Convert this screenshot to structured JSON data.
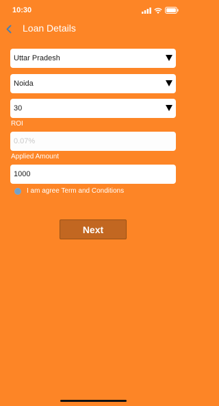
{
  "status_bar": {
    "time": "10:30"
  },
  "header": {
    "title": "Loan Details"
  },
  "form": {
    "state": "Uttar Pradesh",
    "city": "Noida",
    "tenure": "30",
    "roi_label": "ROI",
    "roi_value": "0.07%",
    "applied_amount_label": "Applied Amount",
    "applied_amount_value": "1000",
    "terms_label": "I am agree Term and Conditions",
    "terms_checked": false
  },
  "actions": {
    "next_label": "Next"
  },
  "colors": {
    "background": "#fd8526",
    "button": "#c26721",
    "radio": "#74a1c7"
  },
  "icons": [
    "back-icon",
    "signal-icon",
    "wifi-icon",
    "battery-icon",
    "dropdown-caret-icon"
  ]
}
